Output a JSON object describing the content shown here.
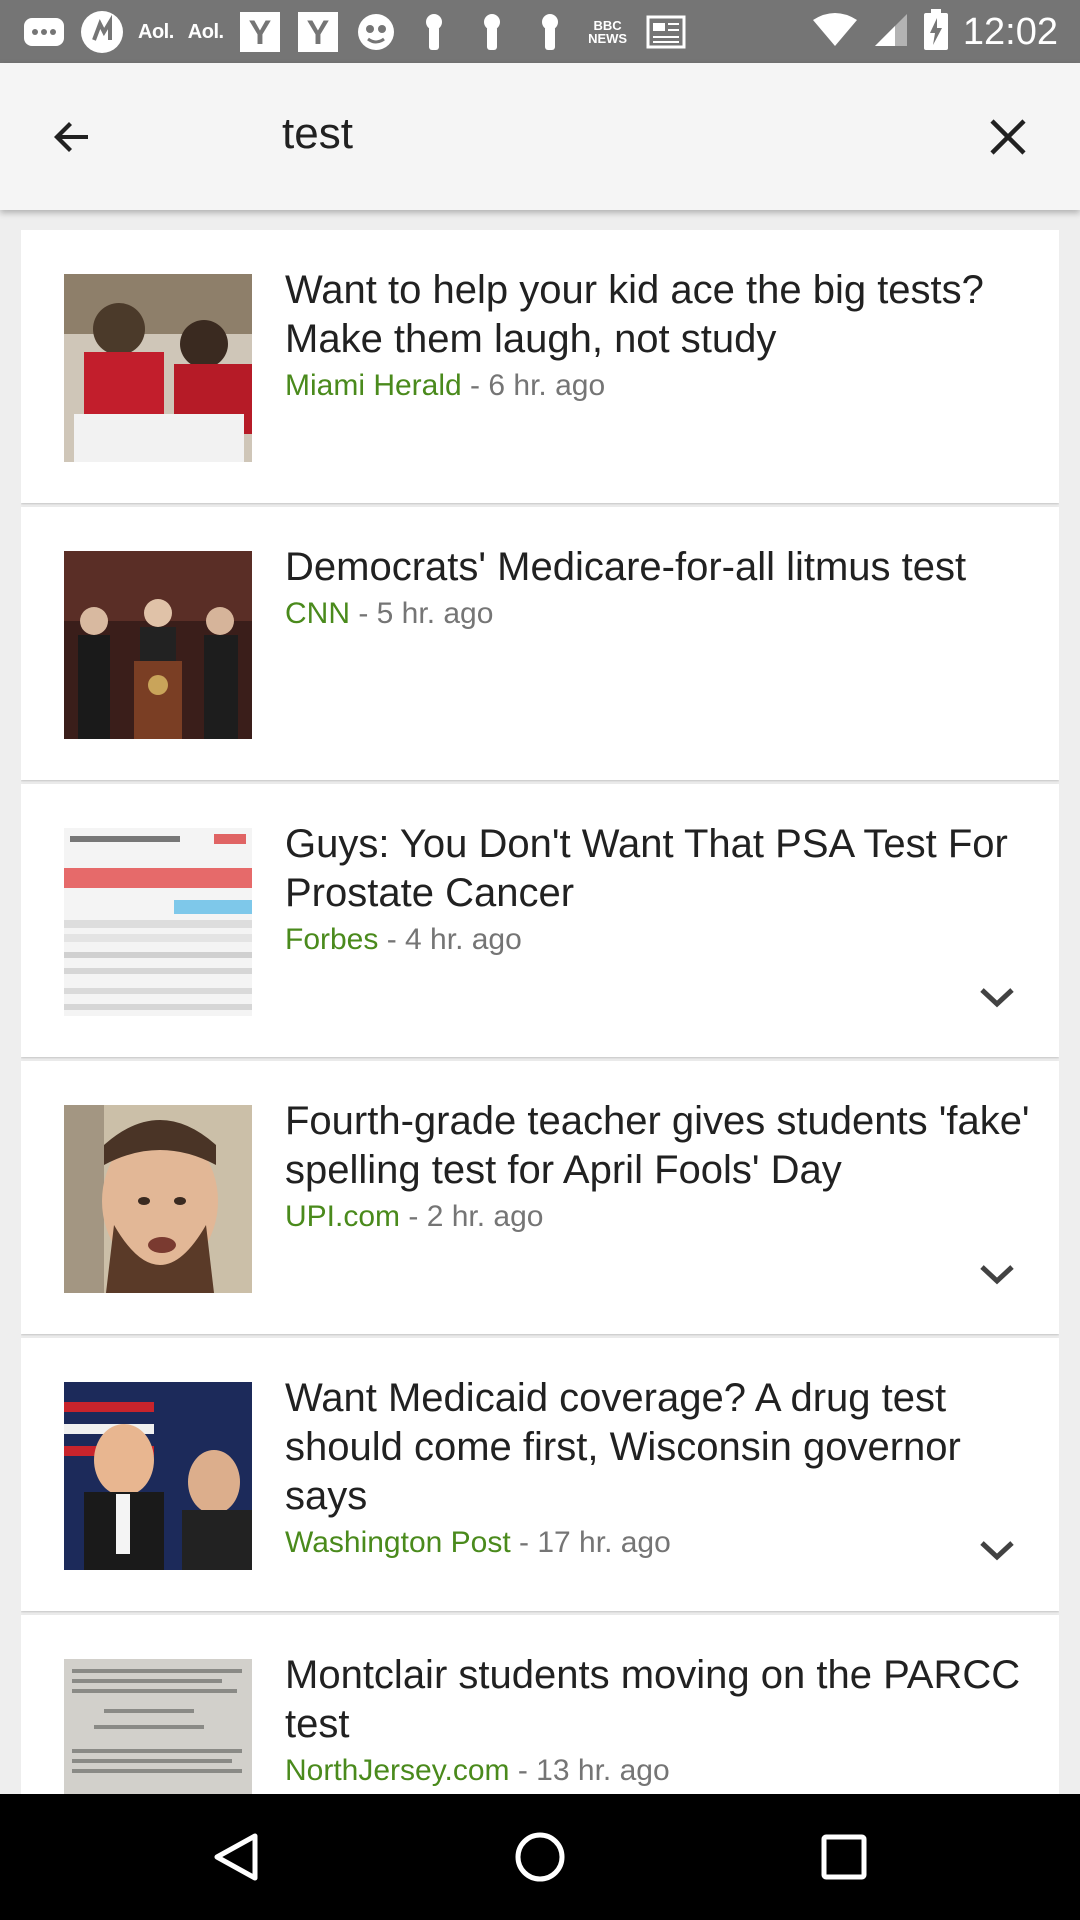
{
  "status_bar": {
    "aol_label_1": "Aol.",
    "aol_label_2": "Aol.",
    "y_label_1": "Y",
    "y_label_2": "Y",
    "bbc_line1": "BBC",
    "bbc_line2": "NEWS",
    "time": "12:02"
  },
  "search": {
    "query": "test"
  },
  "results": [
    {
      "title": "Want to help your kid ace the big tests? Make them laugh, not study",
      "source": "Miami Herald",
      "time": " - 6 hr. ago",
      "has_expand": false
    },
    {
      "title": "Democrats' Medicare-for-all litmus test",
      "source": "CNN",
      "time": " - 5 hr. ago",
      "has_expand": false
    },
    {
      "title": "Guys: You Don't Want That PSA Test For Prostate Cancer",
      "source": "Forbes",
      "time": " - 4 hr. ago",
      "has_expand": true
    },
    {
      "title": "Fourth-grade teacher gives students 'fake' spelling test for April Fools' Day",
      "source": "UPI.com",
      "time": " - 2 hr. ago",
      "has_expand": true
    },
    {
      "title": "Want Medicaid coverage? A drug test should come first, Wisconsin governor says",
      "source": "Washington Post",
      "time": " - 17 hr. ago",
      "has_expand": true
    },
    {
      "title": "Montclair students moving on the PARCC test",
      "source": "NorthJersey.com",
      "time": " - 13 hr. ago",
      "has_expand": false
    }
  ],
  "icons": {
    "back": "arrow-back-icon",
    "clear": "close-icon",
    "expand": "chevron-down-icon",
    "nav_back": "triangle-back-icon",
    "nav_home": "circle-home-icon",
    "nav_recents": "square-recents-icon"
  },
  "colors": {
    "status_bar": "#757575",
    "search_bar": "#f5f5f5",
    "background": "#eeeeee",
    "source_green": "#4a8a1c",
    "meta_gray": "#757575",
    "nav_bar": "#000000"
  }
}
